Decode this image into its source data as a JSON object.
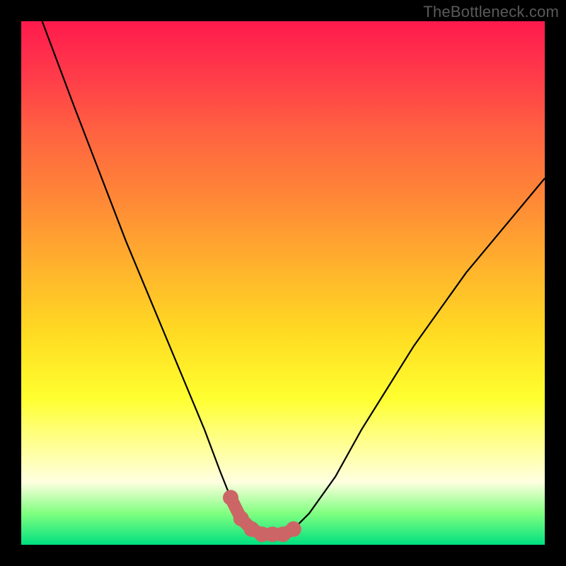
{
  "watermark": "TheBottleneck.com",
  "chart_data": {
    "type": "line",
    "title": "",
    "xlabel": "",
    "ylabel": "",
    "xlim": [
      0,
      100
    ],
    "ylim": [
      0,
      100
    ],
    "series": [
      {
        "name": "bottleneck-curve",
        "x": [
          4,
          10,
          15,
          20,
          25,
          30,
          35,
          38,
          40,
          42,
          44,
          46,
          48,
          50,
          52,
          55,
          60,
          65,
          70,
          75,
          80,
          85,
          90,
          95,
          100
        ],
        "values": [
          100,
          84,
          71,
          58,
          46,
          34,
          22,
          14,
          9,
          5,
          3,
          2,
          2,
          2,
          3,
          6,
          13,
          22,
          30,
          38,
          45,
          52,
          58,
          64,
          70
        ]
      }
    ],
    "highlight": {
      "name": "optimal-zone",
      "x": [
        40,
        42,
        44,
        46,
        48,
        50,
        52
      ],
      "values": [
        9,
        5,
        3,
        2,
        2,
        2,
        3
      ]
    }
  }
}
